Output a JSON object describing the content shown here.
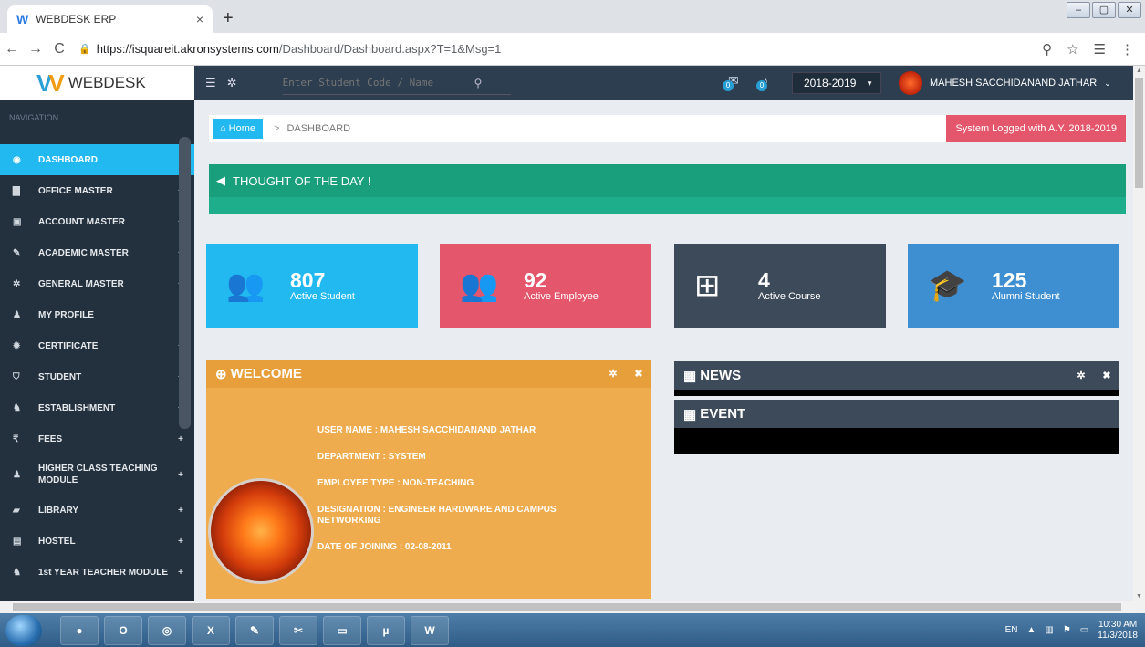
{
  "browser": {
    "tab_title": "WEBDESK ERP",
    "tab_close": "×",
    "new_tab": "+",
    "url_host": "https://isquareit.akronsystems.com",
    "url_path": "/Dashboard/Dashboard.aspx?T=1&Msg=1"
  },
  "logo": {
    "text": "WEBDESK"
  },
  "topbar": {
    "search_placeholder": "Enter Student Code / Name",
    "mail_count": "0",
    "notif_count": "0",
    "year": "2018-2019",
    "user_name": "MAHESH SACCHIDANAND JATHAR"
  },
  "sidebar": {
    "nav_label": "NAVIGATION",
    "items": [
      {
        "label": "DASHBOARD",
        "icon": "dashboard-icon",
        "glyph": "◉",
        "plus": ""
      },
      {
        "label": "OFFICE MASTER",
        "icon": "building-icon",
        "glyph": "▇",
        "plus": "+"
      },
      {
        "label": "ACCOUNT MASTER",
        "icon": "money-icon",
        "glyph": "▣",
        "plus": "+"
      },
      {
        "label": "ACADEMIC MASTER",
        "icon": "edit-icon",
        "glyph": "✎",
        "plus": "+"
      },
      {
        "label": "GENERAL MASTER",
        "icon": "gear-icon",
        "glyph": "✲",
        "plus": "+"
      },
      {
        "label": "MY PROFILE",
        "icon": "user-icon",
        "glyph": "♟",
        "plus": ""
      },
      {
        "label": "CERTIFICATE",
        "icon": "certificate-icon",
        "glyph": "✹",
        "plus": "+"
      },
      {
        "label": "STUDENT",
        "icon": "graduation-icon",
        "glyph": "⛉",
        "plus": "+"
      },
      {
        "label": "ESTABLISHMENT",
        "icon": "users-icon",
        "glyph": "♞",
        "plus": "+"
      },
      {
        "label": "FEES",
        "icon": "rupee-icon",
        "glyph": "₹",
        "plus": "+"
      },
      {
        "label": "HIGHER CLASS TEACHING MODULE",
        "icon": "user-icon",
        "glyph": "♟",
        "plus": "+"
      },
      {
        "label": "LIBRARY",
        "icon": "book-icon",
        "glyph": "▰",
        "plus": "+"
      },
      {
        "label": "HOSTEL",
        "icon": "hostel-icon",
        "glyph": "▤",
        "plus": "+"
      },
      {
        "label": "1st YEAR TEACHER MODULE",
        "icon": "users-icon",
        "glyph": "♞",
        "plus": "+"
      }
    ]
  },
  "breadcrumb": {
    "home": "Home",
    "separator": ">",
    "current": "DASHBOARD",
    "system_badge": "System Logged with A.Y. 2018-2019"
  },
  "thought": {
    "title": "THOUGHT OF THE DAY !"
  },
  "stats": [
    {
      "value": "807",
      "label": "Active Student",
      "color": "#22b8f0"
    },
    {
      "value": "92",
      "label": "Active Employee",
      "color": "#e3566b"
    },
    {
      "value": "4",
      "label": "Active Course",
      "color": "#3d4a5a"
    },
    {
      "value": "125",
      "label": "Alumni Student",
      "color": "#3d8fd1"
    }
  ],
  "welcome": {
    "title": "WELCOME",
    "user_name": "USER NAME  : MAHESH SACCHIDANAND JATHAR",
    "department": "DEPARTMENT : SYSTEM",
    "employee_type": "EMPLOYEE TYPE : NON-TEACHING",
    "designation": "DESIGNATION : ENGINEER HARDWARE AND CAMPUS NETWORKING",
    "doj": "DATE OF JOINING : 02-08-2011"
  },
  "news": {
    "title": "NEWS"
  },
  "event": {
    "title": "EVENT"
  },
  "taskbar": {
    "lang": "EN",
    "time": "10:30 AM",
    "date": "11/3/2018"
  },
  "colors": {
    "accent": "#22b8f0",
    "topbar": "#2c3e50",
    "sidebar": "#23313f",
    "thought": "#1fae8b",
    "welcome": "#efac4e",
    "badge_red": "#e3566b"
  }
}
